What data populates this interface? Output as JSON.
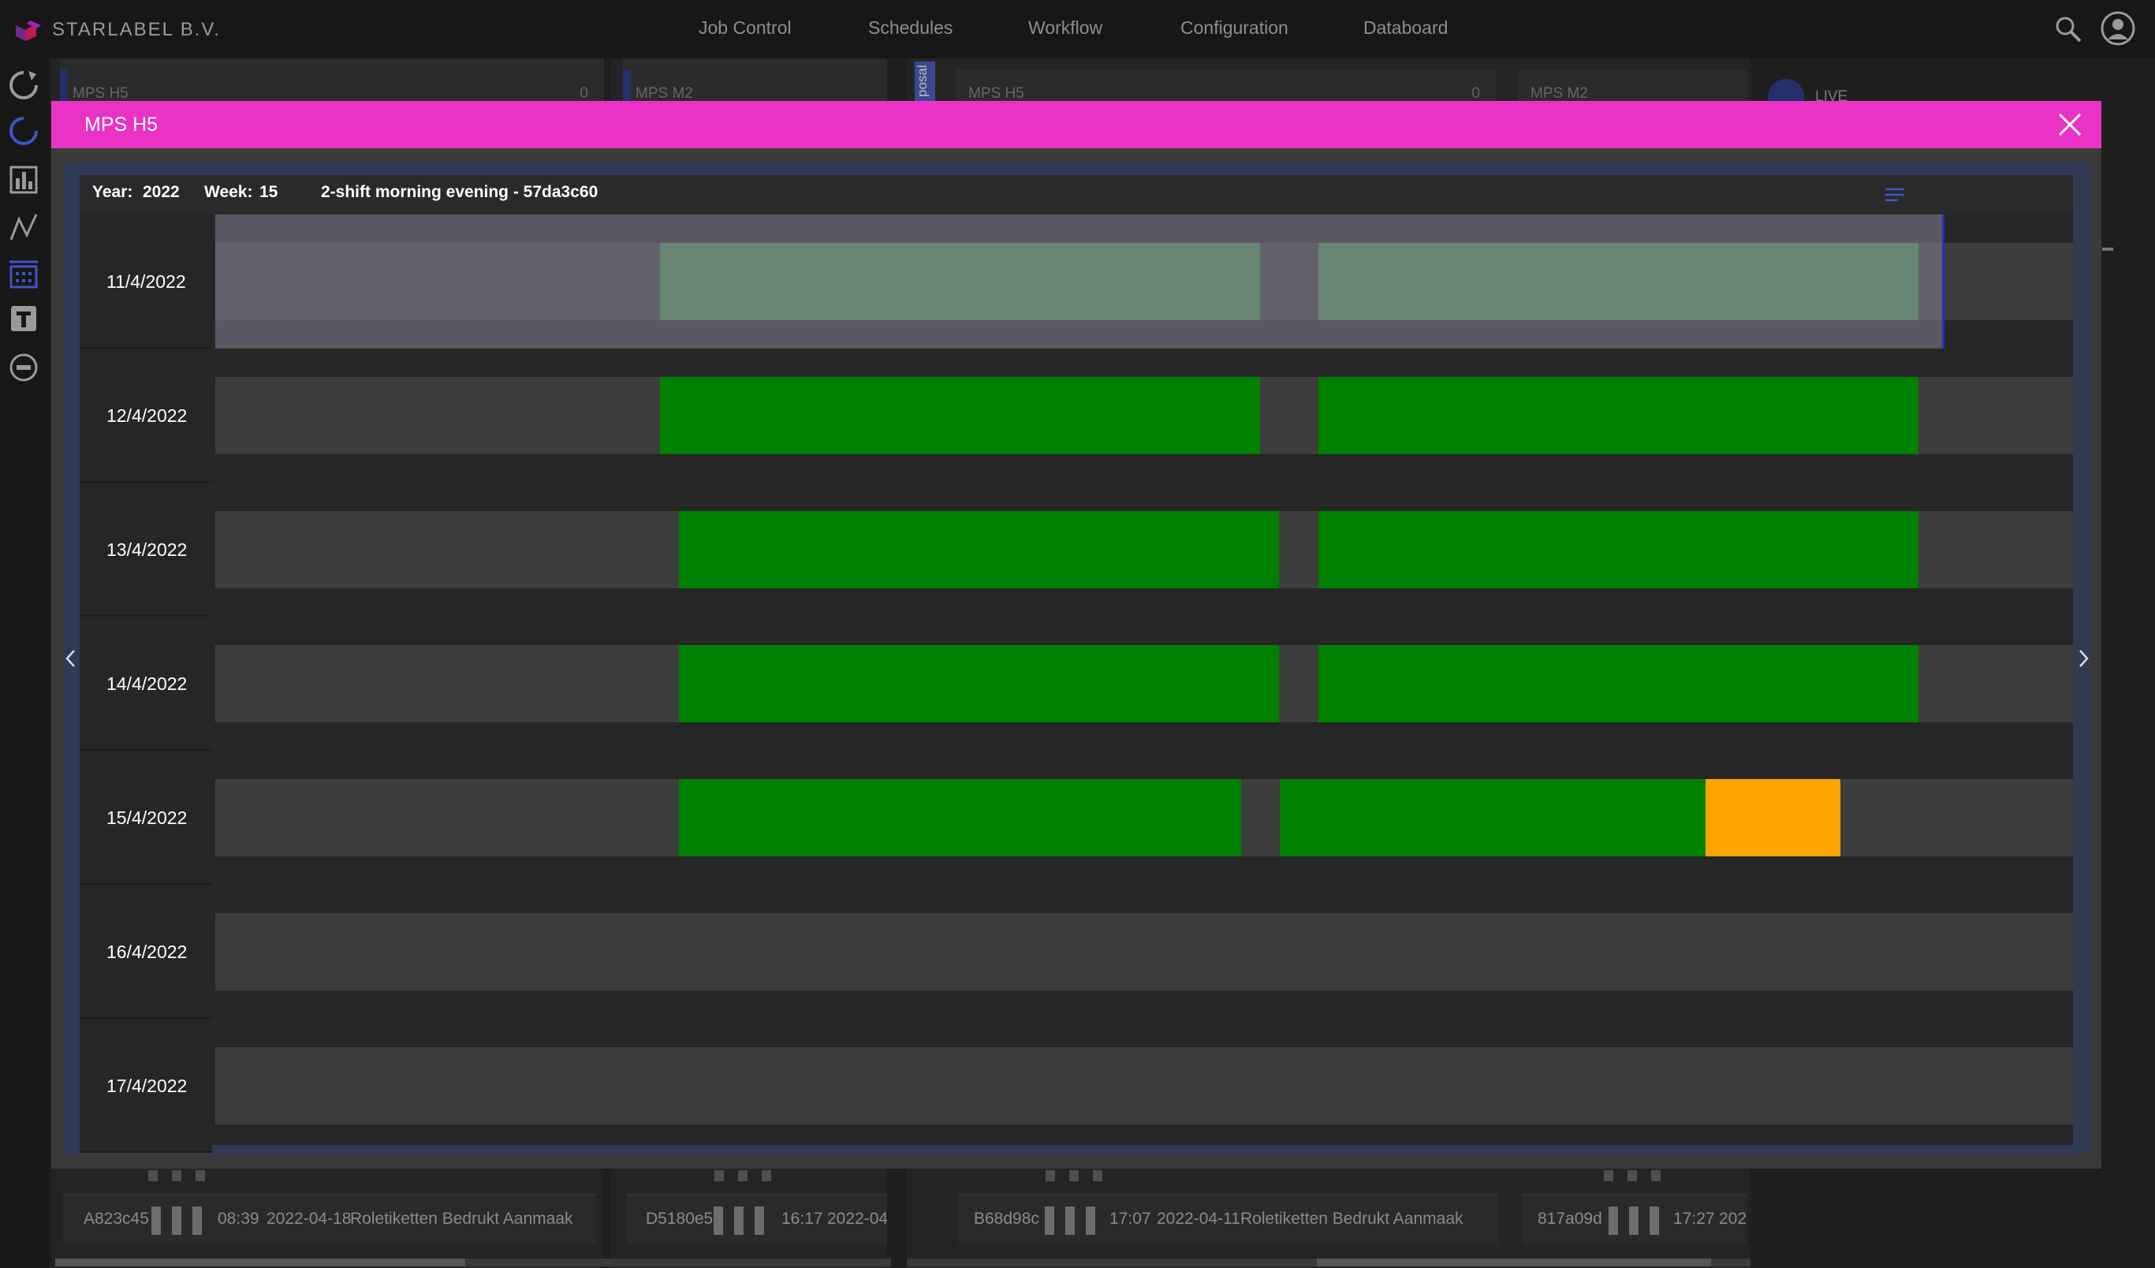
{
  "app": {
    "brand_name": "STARLABEL B.V.",
    "nav": [
      "Job Control",
      "Schedules",
      "Workflow",
      "Configuration",
      "Databoard"
    ],
    "sidebar_icons": [
      "refresh-icon",
      "circle-progress-icon",
      "bar-chart-icon",
      "line-chart-icon",
      "calendar-icon",
      "text-icon",
      "minus-circle-icon"
    ],
    "accent_color": "#3c55c8"
  },
  "background": {
    "panels": [
      {
        "title": "MPS H5",
        "count": "0"
      },
      {
        "title": "MPS M2",
        "count": ""
      },
      {
        "title": "MPS H5",
        "count": "0"
      },
      {
        "title": "MPS M2",
        "count": ""
      }
    ],
    "proposal_tab": "posal",
    "live_label": "LIVE",
    "jobs": [
      {
        "id": "A823c45",
        "time": "08:39",
        "date": "2022-04-18",
        "desc": "Roletiketten Bedrukt Aanmaak"
      },
      {
        "id": "D5180e5",
        "time": "16:17",
        "date": "2022-04-",
        "desc": ""
      },
      {
        "id": "B68d98c",
        "time": "17:07",
        "date": "2022-04-11",
        "desc": "Roletiketten Bedrukt Aanmaak"
      },
      {
        "id": "817a09d",
        "time": "17:27",
        "date": "202",
        "desc": ""
      }
    ]
  },
  "modal": {
    "title": "MPS H5",
    "header_color": "#ea33c6",
    "year_label": "Year:",
    "year": "2022",
    "week_label": "Week:",
    "week": "15",
    "shift_info": "2-shift morning evening - 57da3c60",
    "timeline": {
      "status_colors": {
        "scheduled": "#008000",
        "past": "#468a4a",
        "warning": "#ffa500"
      },
      "days": [
        {
          "date": "11/4/2022",
          "current": true,
          "segments": [
            {
              "start": 0.2394,
              "end": 0.5626,
              "status": "past"
            },
            {
              "start": 0.5938,
              "end": 0.9169,
              "status": "past"
            }
          ]
        },
        {
          "date": "12/4/2022",
          "segments": [
            {
              "start": 0.2394,
              "end": 0.5626,
              "status": "scheduled"
            },
            {
              "start": 0.5938,
              "end": 0.9169,
              "status": "scheduled"
            }
          ]
        },
        {
          "date": "13/4/2022",
          "segments": [
            {
              "start": 0.2496,
              "end": 0.5728,
              "status": "scheduled"
            },
            {
              "start": 0.5938,
              "end": 0.9169,
              "status": "scheduled"
            }
          ]
        },
        {
          "date": "14/4/2022",
          "segments": [
            {
              "start": 0.2496,
              "end": 0.5728,
              "status": "scheduled"
            },
            {
              "start": 0.5938,
              "end": 0.9169,
              "status": "scheduled"
            }
          ]
        },
        {
          "date": "15/4/2022",
          "segments": [
            {
              "start": 0.2496,
              "end": 0.5524,
              "status": "scheduled"
            },
            {
              "start": 0.5728,
              "end": 0.8021,
              "status": "scheduled"
            },
            {
              "start": 0.8021,
              "end": 0.8746,
              "status": "warning"
            }
          ]
        },
        {
          "date": "16/4/2022",
          "segments": []
        },
        {
          "date": "17/4/2022",
          "segments": []
        }
      ]
    }
  }
}
